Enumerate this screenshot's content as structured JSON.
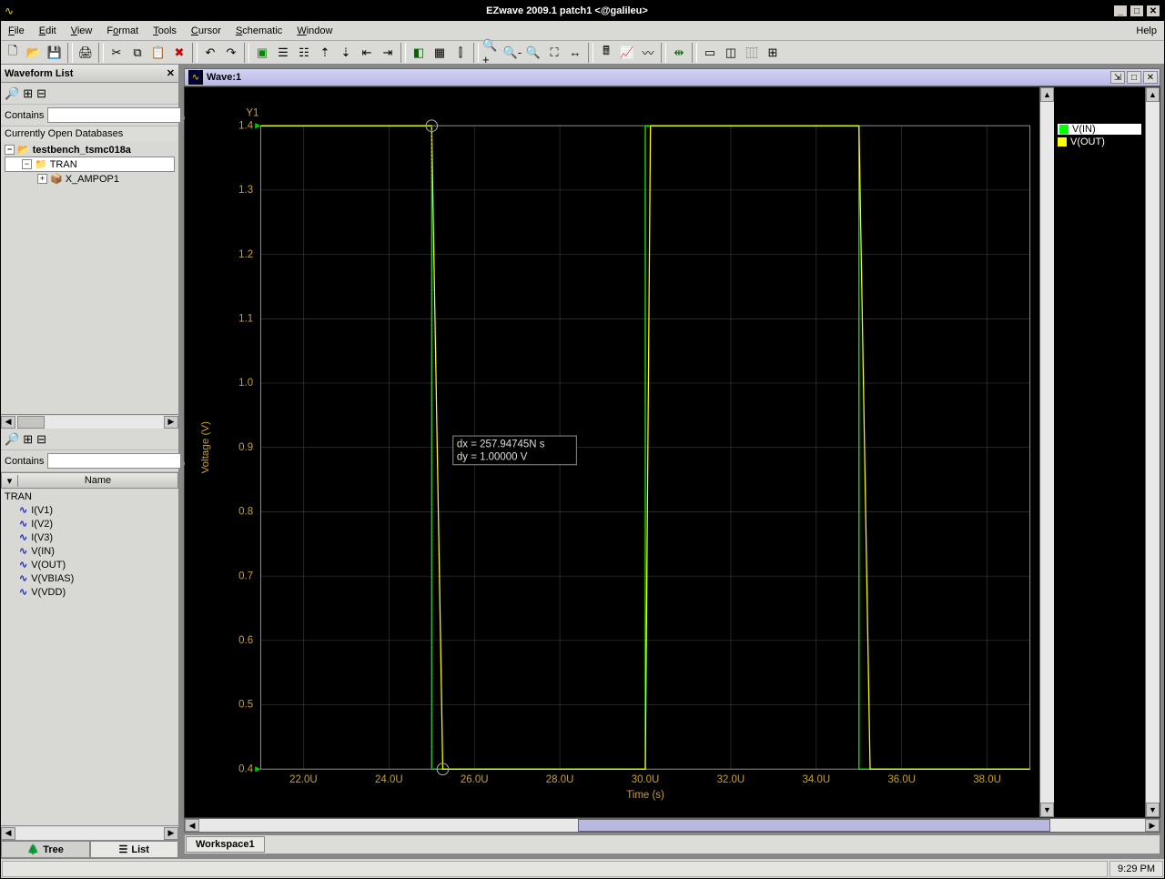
{
  "title": "EZwave 2009.1 patch1 <@galileu>",
  "menu": [
    "File",
    "Edit",
    "View",
    "Format",
    "Tools",
    "Cursor",
    "Schematic",
    "Window"
  ],
  "menu_help": "Help",
  "panel": {
    "title": "Waveform List",
    "contains_label": "Contains",
    "db_header": "Currently Open Databases",
    "tree": {
      "root": "testbench_tsmc018a",
      "child1": "TRAN",
      "child2": "X_AMPOP1"
    },
    "name_col": "Name",
    "sig_group": "TRAN",
    "signals": [
      "I(V1)",
      "I(V2)",
      "I(V3)",
      "V(IN)",
      "V(OUT)",
      "V(VBIAS)",
      "V(VDD)"
    ],
    "tabs": {
      "tree": "Tree",
      "list": "List"
    }
  },
  "wave": {
    "title": "Wave:1",
    "y_axis_title": "Y1",
    "y_label": "Voltage (V)",
    "x_label": "Time (s)",
    "y_ticks": [
      "1.4",
      "1.3",
      "1.2",
      "1.1",
      "1.0",
      "0.9",
      "0.8",
      "0.7",
      "0.6",
      "0.5",
      "0.4"
    ],
    "x_ticks": [
      "22.0U",
      "24.0U",
      "26.0U",
      "28.0U",
      "30.0U",
      "32.0U",
      "34.0U",
      "36.0U",
      "38.0U"
    ],
    "cursor_dx": "dx = 257.94745N s",
    "cursor_dy": "dy = 1.00000 V",
    "legend": [
      {
        "name": "V(IN)",
        "color": "green",
        "selected": true
      },
      {
        "name": "V(OUT)",
        "color": "yellow",
        "selected": false
      }
    ]
  },
  "workspace_tab": "Workspace1",
  "status_time": "9:29 PM",
  "chart_data": {
    "type": "line",
    "title": "Wave:1",
    "xlabel": "Time (s)",
    "ylabel": "Voltage (V)",
    "xlim": [
      2.1e-05,
      3.9e-05
    ],
    "ylim": [
      0.4,
      1.4
    ],
    "series": [
      {
        "name": "V(IN)",
        "color": "#00ff00",
        "x": [
          2.1e-05,
          2.5e-05,
          2.5e-05,
          3e-05,
          3e-05,
          3.5e-05,
          3.5e-05,
          3.9e-05
        ],
        "y": [
          1.4,
          1.4,
          0.4,
          0.4,
          1.4,
          1.4,
          0.4,
          0.4
        ]
      },
      {
        "name": "V(OUT)",
        "color": "#ffff00",
        "x": [
          2.1e-05,
          2.5e-05,
          2.526e-05,
          3e-05,
          3.012e-05,
          3.5e-05,
          3.526e-05,
          3.9e-05
        ],
        "y": [
          1.4,
          1.4,
          0.4,
          0.4,
          1.4,
          1.4,
          0.4,
          0.4
        ]
      }
    ],
    "cursor": {
      "x1": 2.5e-05,
      "x2": 2.5258e-05,
      "dx_seconds": 2.5794745e-07,
      "dy_volts": 1.0
    }
  }
}
